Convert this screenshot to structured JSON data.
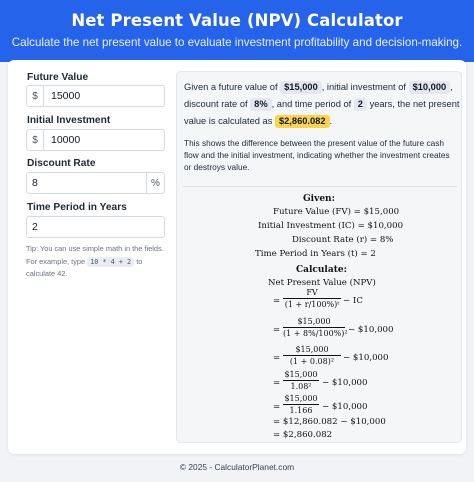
{
  "header": {
    "title": "Net Present Value (NPV) Calculator",
    "subtitle": "Calculate the net present value to evaluate investment profitability and decision-making."
  },
  "inputs": {
    "future_value": {
      "label": "Future Value",
      "prefix": "$",
      "value": "15000"
    },
    "initial_investment": {
      "label": "Initial Investment",
      "prefix": "$",
      "value": "10000"
    },
    "discount_rate": {
      "label": "Discount Rate",
      "value": "8",
      "suffix": "%"
    },
    "time_period": {
      "label": "Time Period in Years",
      "value": "2"
    }
  },
  "tip": {
    "text_before": "Tip: You can use simple math in the fields. For example, type",
    "code": "10 * 4 + 2",
    "text_after": "to calculate 42."
  },
  "summary": {
    "p1": "Given a future value of",
    "fv": "$15,000",
    "p2": ", initial investment of",
    "ic": "$10,000",
    "p3": ",",
    "p4": "discount rate of",
    "rate": "8%",
    "p5": ", and time period of",
    "time": "2",
    "p6": "years, the net present",
    "p7": "value is calculated as",
    "result": "$2,860.082",
    "p8": ".",
    "explain": "This shows the difference between the present value of the future cash flow and the initial investment, indicating whether the investment creates or destroys value."
  },
  "math": {
    "given_heading": "Given:",
    "given_lines": [
      "Future Value (FV) = $15,000",
      "Initial Investment (IC) = $10,000",
      "Discount Rate (r) = 8%",
      "Time Period in Years (t) = 2"
    ],
    "calc_heading": "Calculate:",
    "npv_label": "Net Present Value (NPV)",
    "eq1_num": "FV",
    "eq1_den": "(1 + r/100%)ᵗ",
    "eq1_rest": "− IC",
    "eq2_num": "$15,000",
    "eq2_den": "(1 + 8%/100%)²",
    "eq2_rest": "− $10,000",
    "eq3_num": "$15,000",
    "eq3_den": "(1 + 0.08)²",
    "eq3_rest": "− $10,000",
    "eq4_num": "$15,000",
    "eq4_den": "1.08²",
    "eq4_rest": "− $10,000",
    "eq5_num": "$15,000",
    "eq5_den": "1.166",
    "eq5_rest": "− $10,000",
    "eq6": "= $12,860.082 − $10,000",
    "eq7": "= $2,860.082"
  },
  "footer": "© 2025 - CalculatorPlanet.com"
}
